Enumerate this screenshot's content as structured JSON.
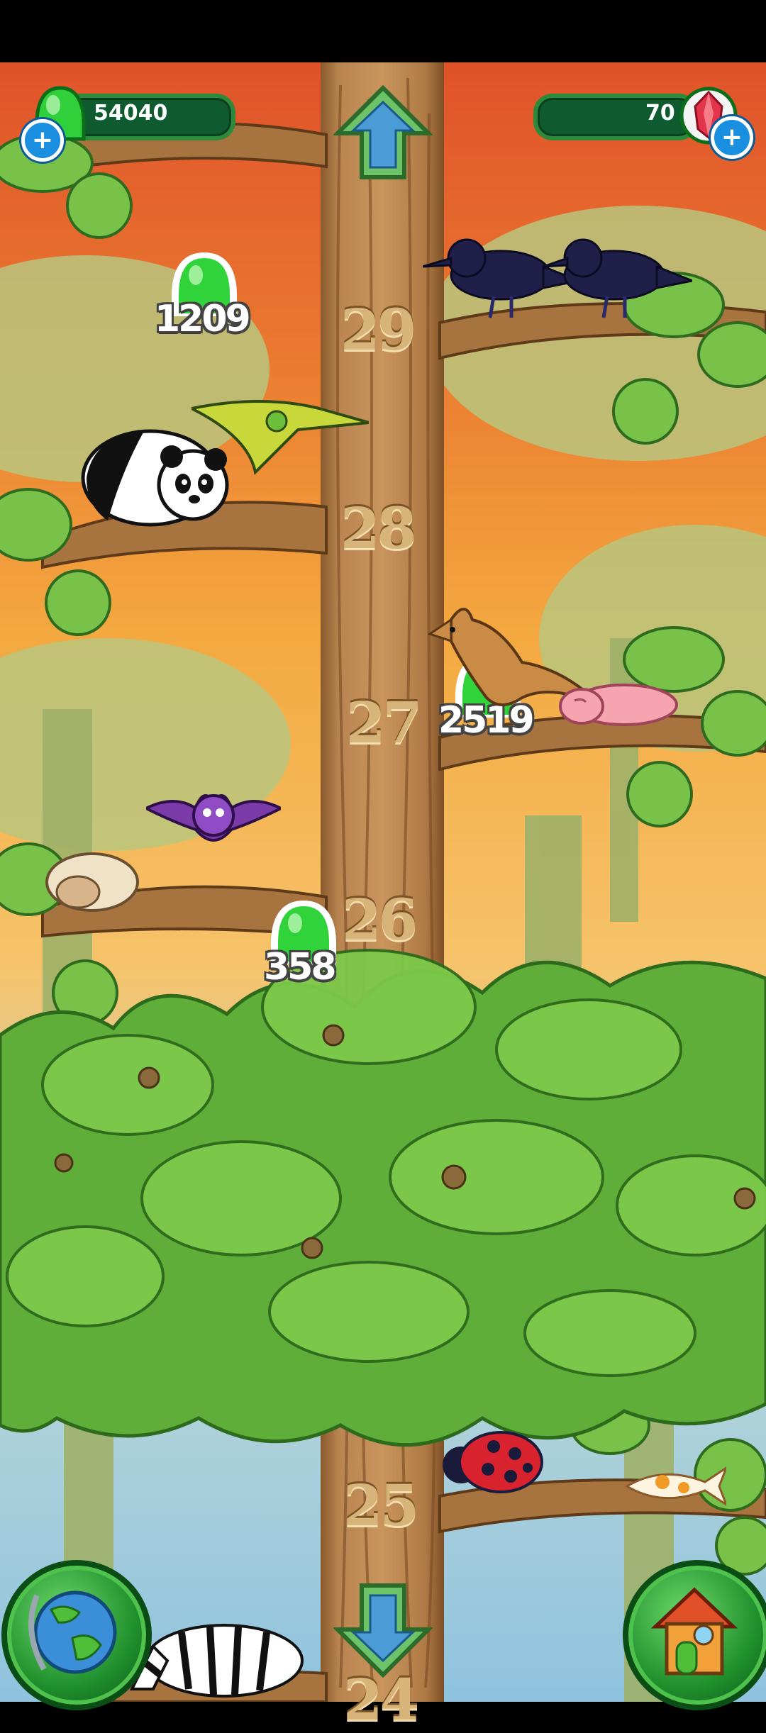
{
  "hud": {
    "gems_count": "54040",
    "crystals_count": "70",
    "add_gems_label": "+",
    "add_crystals_label": "+"
  },
  "floors": [
    {
      "label": "29"
    },
    {
      "label": "28"
    },
    {
      "label": "27"
    },
    {
      "label": "26"
    },
    {
      "label": "25"
    },
    {
      "label": "24"
    }
  ],
  "collectibles": [
    {
      "value": "1209"
    },
    {
      "value": "2519"
    },
    {
      "value": "358"
    }
  ],
  "animals": [
    "crow",
    "crow",
    "panda",
    "pterodactyl",
    "kangaroo",
    "naked-mole-rat",
    "bat",
    "sheep",
    "ladybug",
    "koi-fish",
    "zebra"
  ],
  "controls": [
    "scroll-up-arrow",
    "scroll-down-arrow",
    "globe-map-button",
    "home-button"
  ],
  "colors": {
    "sky_top": "#e8642a",
    "sky_mid": "#f2a03a",
    "trunk": "#b8824d",
    "foliage": "#5fae3a",
    "gem_green": "#35d43a",
    "hud_green": "#0f5a2e"
  }
}
